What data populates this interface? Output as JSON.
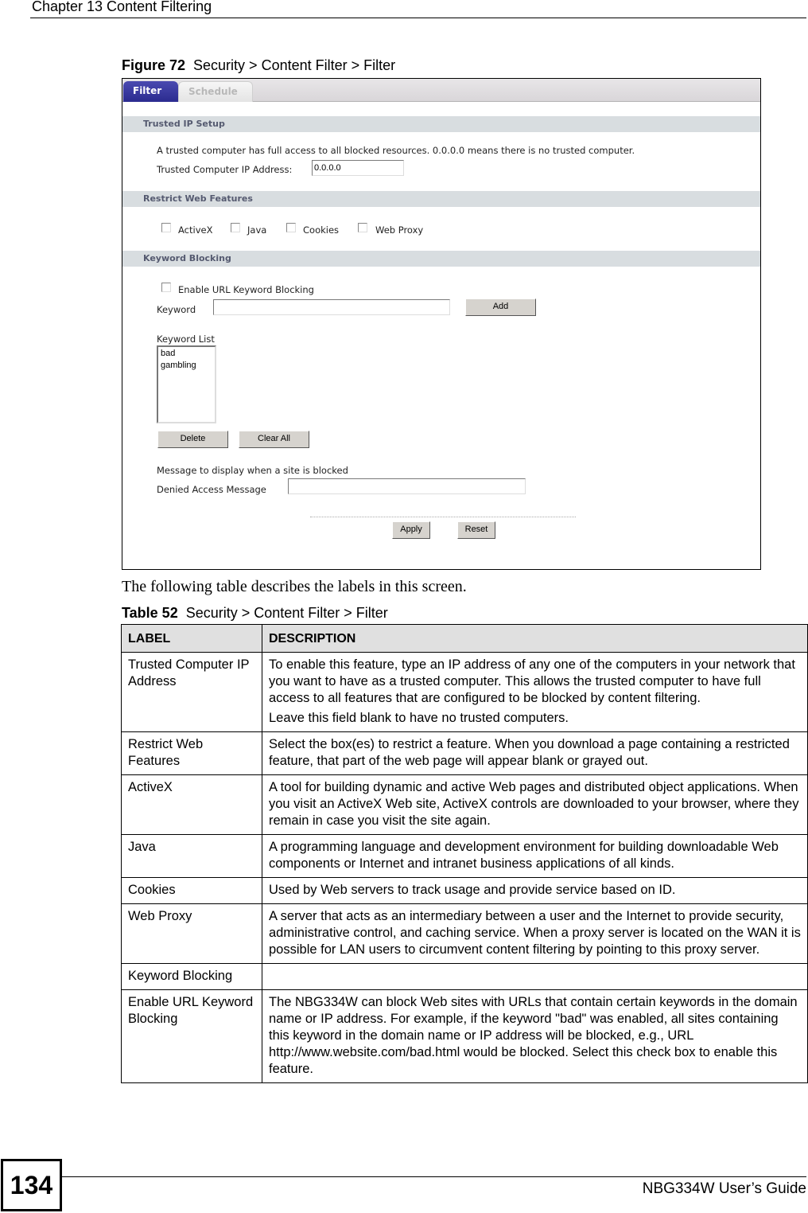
{
  "page": {
    "chapter_title": "Chapter 13 Content Filtering",
    "page_number": "134",
    "guide_name": "NBG334W User’s Guide"
  },
  "figure": {
    "label": "Figure 72",
    "title": "Security > Content Filter > Filter"
  },
  "ui": {
    "tabs": [
      {
        "label": "Filter",
        "active": true
      },
      {
        "label": "Schedule",
        "active": false
      }
    ],
    "trusted_ip": {
      "section_title": "Trusted IP Setup",
      "description": "A trusted computer has full access to all blocked resources. 0.0.0.0 means there is no trusted computer.",
      "ip_label": "Trusted Computer IP Address:",
      "ip_value": "0.0.0.0"
    },
    "restrict_web": {
      "section_title": "Restrict Web Features",
      "options": [
        {
          "label": "ActiveX",
          "checked": false
        },
        {
          "label": "Java",
          "checked": false
        },
        {
          "label": "Cookies",
          "checked": false
        },
        {
          "label": "Web Proxy",
          "checked": false
        }
      ]
    },
    "keyword_blocking": {
      "section_title": "Keyword Blocking",
      "enable_label": "Enable URL Keyword Blocking",
      "enable_checked": false,
      "keyword_label": "Keyword",
      "keyword_value": "",
      "add_button": "Add",
      "list_label": "Keyword List",
      "keywords": [
        "bad",
        "gambling"
      ],
      "delete_button": "Delete",
      "clear_all_button": "Clear All",
      "message_heading": "Message to display when a site is blocked",
      "denied_label": "Denied Access Message",
      "denied_value": ""
    },
    "apply_button": "Apply",
    "reset_button": "Reset"
  },
  "intro_text": "The following table describes the labels in this screen.",
  "table": {
    "label": "Table 52",
    "title": "Security > Content Filter > Filter",
    "headers": [
      "LABEL",
      "DESCRIPTION"
    ],
    "rows": [
      {
        "label": "Trusted Computer IP Address",
        "description": [
          "To enable this feature, type an IP address of any one of the computers in your network that you want to have as a trusted computer. This allows the trusted computer to have full access to all features that are configured to be blocked by content filtering.",
          "Leave this field blank to have no trusted computers."
        ]
      },
      {
        "label": "Restrict Web Features",
        "description": [
          "Select the box(es) to restrict a feature. When you download a page containing a restricted feature, that part of the web page will appear blank or grayed out."
        ]
      },
      {
        "label": "ActiveX",
        "description": [
          "A tool for building dynamic and active Web pages and distributed object applications. When you visit an ActiveX Web site, ActiveX controls are downloaded to your browser, where they remain in case you visit the site again."
        ]
      },
      {
        "label": "Java",
        "description": [
          "A programming language and development environment for building downloadable Web components or Internet and intranet business applications of all kinds."
        ]
      },
      {
        "label": "Cookies",
        "description": [
          "Used by Web servers to track usage and provide service based on ID."
        ]
      },
      {
        "label": "Web Proxy",
        "description": [
          "A server that acts as an intermediary between a user and the Internet to provide security, administrative control, and caching service. When a proxy server is located on the WAN it is possible for LAN users to circumvent content filtering by pointing to this proxy server."
        ]
      },
      {
        "label": "Keyword Blocking",
        "description": [
          ""
        ]
      },
      {
        "label": "Enable URL Keyword Blocking",
        "description": [
          "The NBG334W can block Web sites with URLs that contain certain keywords in the domain name or IP address. For example, if the keyword \"bad\" was enabled, all sites containing this keyword in the domain name or IP address will be blocked, e.g., URL http://www.website.com/bad.html would be blocked. Select this check box to enable this feature."
        ]
      }
    ]
  }
}
